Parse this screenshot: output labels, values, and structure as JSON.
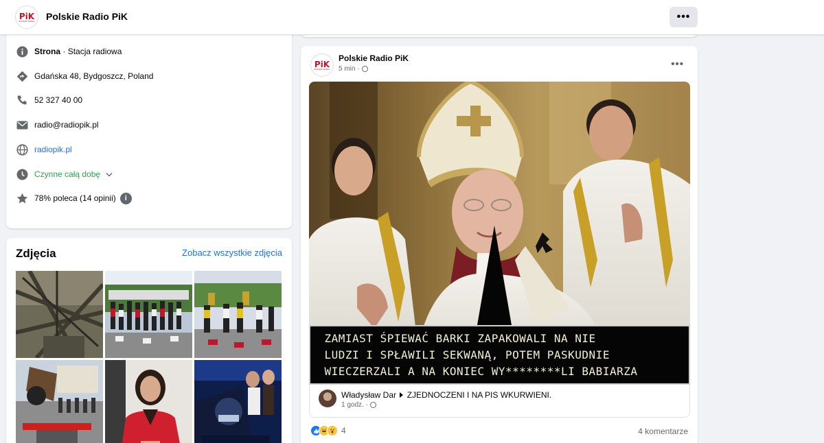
{
  "header": {
    "page_name": "Polskie Radio PiK",
    "logo_text": "PiK",
    "logo_subtext": "POLSKIE RADIO",
    "more_label": "•••"
  },
  "info": {
    "type_label": "Strona",
    "type_value": "· Stacja radiowa",
    "address": "Gdańska 48, Bydgoszcz, Poland",
    "phone": "52 327 40 00",
    "email": "radio@radiopik.pl",
    "website": "radiopik.pl",
    "hours": "Czynne całą dobę",
    "rating": "78% poleca (14 opinii)",
    "info_icon": "i"
  },
  "photos": {
    "title": "Zdjęcia",
    "see_all": "Zobacz wszystkie zdjęcia"
  },
  "post": {
    "author": "Polskie Radio PiK",
    "time": "5 min ·",
    "more_label": "•••",
    "caption_lines": [
      "ZAMIAST ŚPIEWAĆ BARKI ZAPAKOWALI NA NIE",
      "LUDZI I SPŁAWILI SEKWANĄ, POTEM PASKUDNIE",
      "WIECZERZALI A NA KONIEC WY********LI BABIARZA"
    ],
    "shared_by": "Władysław Dar",
    "shared_group": "ZJEDNOCZENI I NA PIS WKURWIENI.",
    "shared_time": "1 godz. ·",
    "reaction_count": "4",
    "comments": "4 komentarze"
  },
  "colors": {
    "link": "#216fdb",
    "open_status": "#2f9e4f",
    "logo_red": "#c0162b"
  }
}
